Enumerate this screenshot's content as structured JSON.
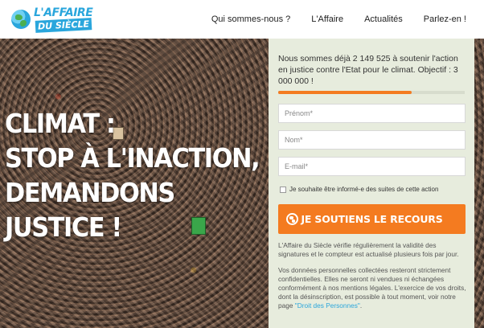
{
  "header": {
    "logo_line1": "L'AFFAIRE",
    "logo_line2": "DU SIÈCLE",
    "nav": [
      {
        "label": "Qui sommes-nous ?"
      },
      {
        "label": "L'Affaire"
      },
      {
        "label": "Actualités"
      },
      {
        "label": "Parlez-en !"
      }
    ]
  },
  "hero": {
    "title_lines": [
      "CLIMAT :",
      "STOP À L'INACTION,",
      "DEMANDONS",
      "JUSTICE !"
    ]
  },
  "signup": {
    "intro": "Nous sommes déjà 2 149 525 à soutenir l'action en justice contre l'Etat pour le climat. Objectif : 3 000 000 !",
    "supporters": 2149525,
    "goal": 3000000,
    "progress_fraction": 0.7165,
    "fields": {
      "firstname_placeholder": "Prénom*",
      "lastname_placeholder": "Nom*",
      "email_placeholder": "E-mail*"
    },
    "checkbox_label": "Je souhaite être informé-e des suites de cette action",
    "submit_label": "JE SOUTIENS LE RECOURS",
    "verify_note": "L'Affaire du Siècle vérifie régulièrement la validité des signatures et le compteur est actualisé plusieurs fois par jour.",
    "privacy_note": "Vos données personnelles collectées resteront strictement confidentielles. Elles ne seront ni vendues ni échangées conformément à nos mentions légales. L'exercice de vos droits, dont la désinscription, est possible à tout moment, voir notre page",
    "privacy_link": "\"Droit des Personnes\"",
    "privacy_end": "."
  },
  "colors": {
    "accent": "#f47b20",
    "brand_blue": "#2aa6dc",
    "panel_bg": "#e7ecdd"
  },
  "icons": {
    "logo": "globe-icon",
    "submit": "globe-icon"
  }
}
